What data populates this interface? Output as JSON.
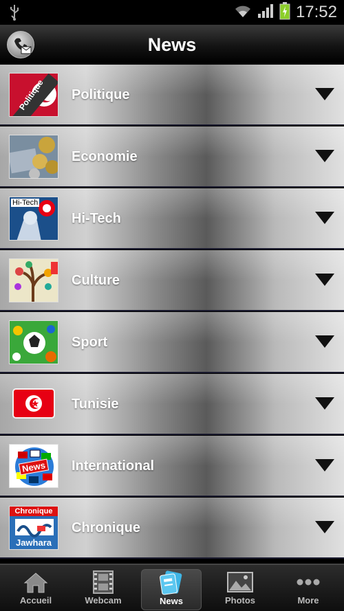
{
  "status": {
    "time": "17:52"
  },
  "header": {
    "title": "News",
    "left_icon": "phone-mail-icon"
  },
  "news_categories": [
    {
      "label": "Politique",
      "thumb_text": "Politique"
    },
    {
      "label": "Economie"
    },
    {
      "label": "Hi-Tech",
      "thumb_text": "Hi-Tech"
    },
    {
      "label": "Culture"
    },
    {
      "label": "Sport"
    },
    {
      "label": "Tunisie"
    },
    {
      "label": "International",
      "thumb_text": "News"
    },
    {
      "label": "Chronique",
      "thumb_text": "Chronique",
      "thumb_text2": "Jawhara"
    }
  ],
  "tabs": [
    {
      "label": "Accueil",
      "icon": "home-icon"
    },
    {
      "label": "Webcam",
      "icon": "film-icon"
    },
    {
      "label": "News",
      "icon": "news-icon",
      "active": true
    },
    {
      "label": "Photos",
      "icon": "photos-icon"
    },
    {
      "label": "More",
      "icon": "more-icon"
    }
  ],
  "colors": {
    "accent": "#3fb5e5",
    "tunisia_red": "#e70013"
  }
}
